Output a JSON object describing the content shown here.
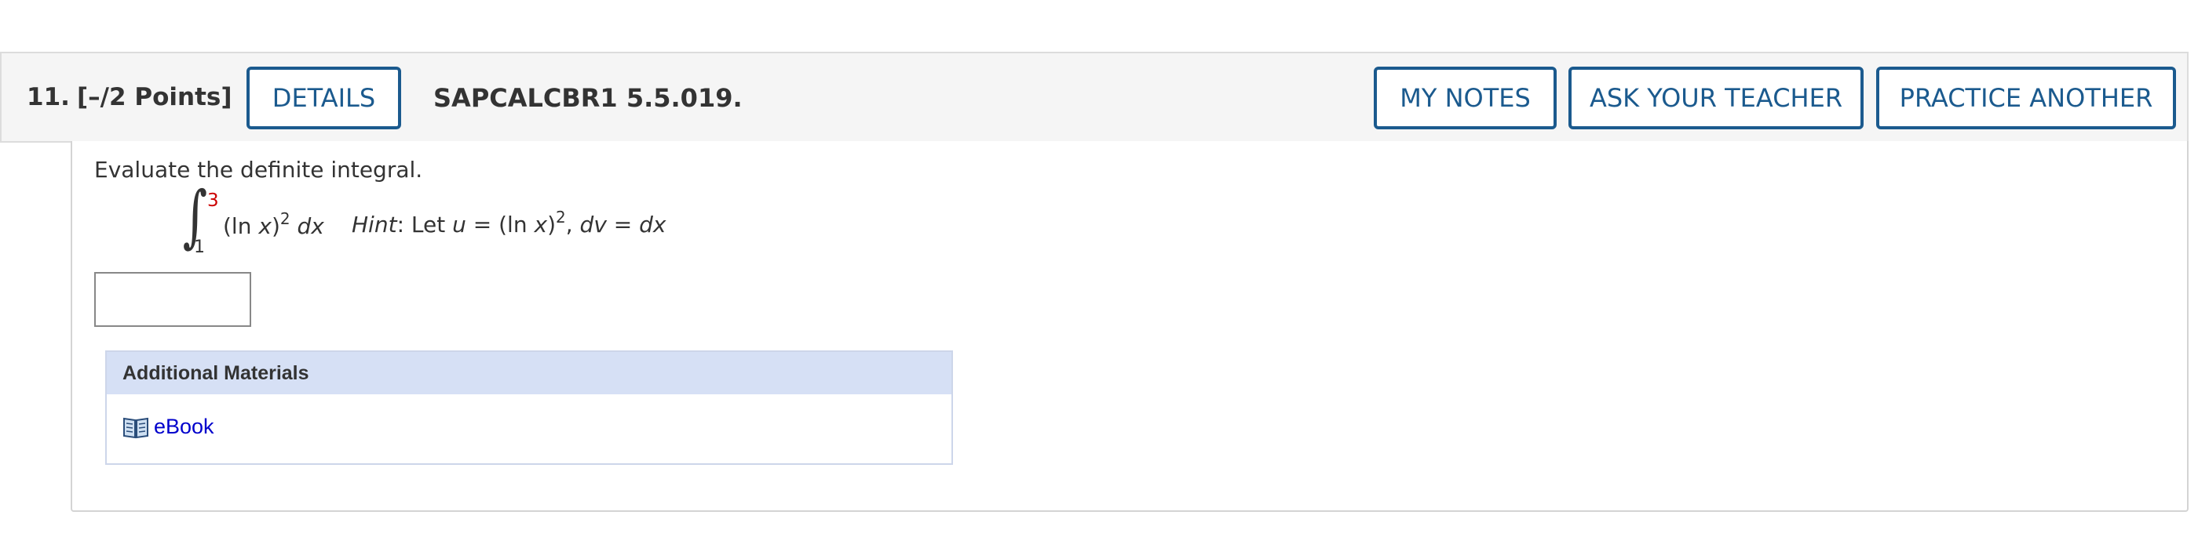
{
  "question": {
    "number": "11.",
    "points": "[–/2 Points]",
    "details_label": "DETAILS",
    "code": "SAPCALCBR1 5.5.019.",
    "my_notes_label": "MY NOTES",
    "ask_teacher_label": "ASK YOUR TEACHER",
    "practice_label": "PRACTICE ANOTHER"
  },
  "body": {
    "prompt": "Evaluate the definite integral.",
    "integral": {
      "upper_limit": "3",
      "lower_limit": "1",
      "integrand_base": "(ln ",
      "integrand_var": "x",
      "integrand_close": ")",
      "integrand_exp": "2",
      "differential": "dx"
    },
    "hint": {
      "label": "Hint",
      "text1": ": Let ",
      "u": "u",
      "eq1": " = (ln ",
      "x": "x",
      "close": ")",
      "exp": "2",
      "comma": ", ",
      "dv": "dv",
      "eq2": " = ",
      "dx": "dx"
    },
    "answer_value": ""
  },
  "additional_materials": {
    "title": "Additional Materials",
    "ebook_label": "eBook",
    "ebook_icon": "book-icon"
  },
  "colors": {
    "button_border": "#1b5a8e",
    "upper_limit": "#cc0000",
    "link": "#0000cc",
    "materials_header": "#d6e0f5"
  }
}
